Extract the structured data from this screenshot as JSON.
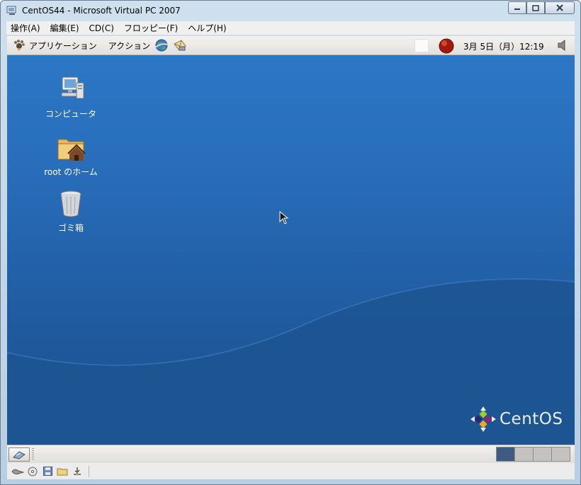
{
  "window": {
    "title": "CentOS44 - Microsoft Virtual PC 2007",
    "caption_buttons": [
      "minimize",
      "maximize",
      "close"
    ]
  },
  "vpc_menubar": {
    "items": [
      "操作(A)",
      "編集(E)",
      "CD(C)",
      "フロッピー(F)",
      "ヘルプ(H)"
    ]
  },
  "top_panel": {
    "applications_label": "アプリケーション",
    "actions_label": "アクション",
    "launchers": [
      "web-browser-icon",
      "mail-icon"
    ],
    "clock": "3月 5日（月）12:19"
  },
  "desktop": {
    "icons": [
      {
        "label": "コンピュータ",
        "icon": "computer-icon"
      },
      {
        "label": "root のホーム",
        "icon": "home-folder-icon"
      },
      {
        "label": "ゴミ箱",
        "icon": "trash-icon"
      }
    ],
    "logo_text": "CentOS"
  },
  "bottom_panel": {
    "workspaces": 4,
    "active_workspace": 1
  },
  "vpc_statusbar": {
    "icons": [
      "network-icon",
      "cd-icon",
      "floppy-icon",
      "shared-folder-icon",
      "usb-icon"
    ]
  },
  "colors": {
    "desktop_top": "#2c77c6",
    "desktop_bottom": "#1c5390",
    "active_workspace": "#3f5a83"
  }
}
